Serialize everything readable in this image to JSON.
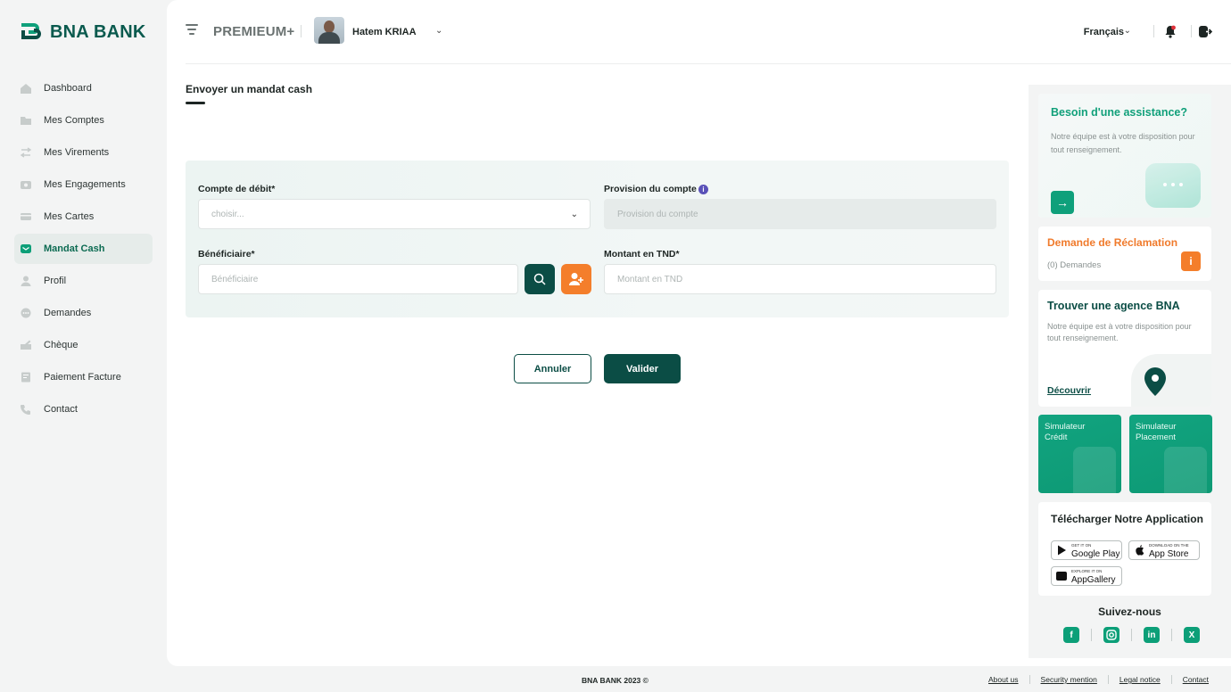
{
  "brand": {
    "name": "BNA BANK",
    "accent": "#0b4d45",
    "green": "#11a07a",
    "orange": "#f47e2b"
  },
  "sidebar": {
    "items": [
      {
        "label": "Dashboard",
        "icon": "home-icon"
      },
      {
        "label": "Mes Comptes",
        "icon": "folder-icon"
      },
      {
        "label": "Mes Virements",
        "icon": "transfer-icon"
      },
      {
        "label": "Mes Engagements",
        "icon": "camera-icon"
      },
      {
        "label": "Mes Cartes",
        "icon": "card-icon"
      },
      {
        "label": "Mandat Cash",
        "icon": "mail-icon",
        "active": true
      },
      {
        "label": "Profil",
        "icon": "user-icon"
      },
      {
        "label": "Demandes",
        "icon": "chat-icon"
      },
      {
        "label": "Chèque",
        "icon": "cheque-icon"
      },
      {
        "label": "Paiement Facture",
        "icon": "invoice-icon"
      },
      {
        "label": "Contact",
        "icon": "phone-icon"
      }
    ]
  },
  "header": {
    "tier": "PREMIEUM+",
    "user_name": "Hatem KRIAA",
    "language": "Français"
  },
  "page": {
    "title": "Envoyer un mandat cash"
  },
  "form": {
    "debit_label": "Compte de débit*",
    "debit_placeholder": "choisir...",
    "provision_label": "Provision du compte",
    "provision_placeholder": "Provision du compte",
    "beneficiary_label": "Bénéficiaire*",
    "beneficiary_placeholder": "Bénéficiaire",
    "amount_label": "Montant en TND*",
    "amount_placeholder": "Montant en TND",
    "cancel_label": "Annuler",
    "submit_label": "Valider"
  },
  "right": {
    "assist_title": "Besoin d'une assistance?",
    "assist_text": "Notre équipe est à votre disposition pour tout renseignement.",
    "reclam_title": "Demande de Réclamation",
    "reclam_sub": "(0) Demandes",
    "agence_title": "Trouver une agence BNA",
    "agence_text": "Notre équipe est à votre disposition pour tout renseignement.",
    "agence_link": "Découvrir",
    "sim_credit": "Simulateur Crédit",
    "sim_placement": "Simulateur Placement",
    "app_title": "Télécharger Notre Application",
    "stores": [
      {
        "small": "GET IT ON",
        "big": "Google Play"
      },
      {
        "small": "Download on the",
        "big": "App Store"
      },
      {
        "small": "EXPLORE IT ON",
        "big": "AppGallery"
      }
    ],
    "follow": "Suivez-nous"
  },
  "footer": {
    "copyright": "BNA BANK 2023 ©",
    "links": [
      "About us",
      "Security mention",
      "Legal notice",
      "Contact"
    ]
  }
}
